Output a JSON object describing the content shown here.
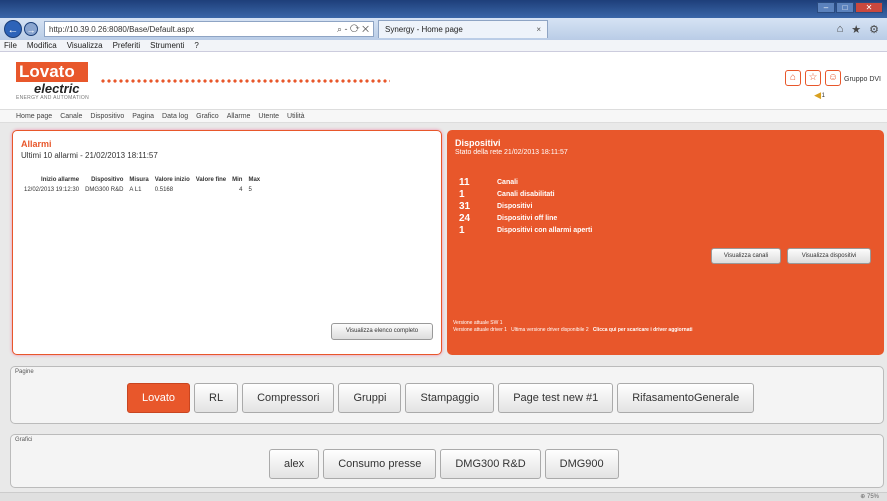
{
  "browser": {
    "url": "http://10.39.0.26:8080/Base/Default.aspx",
    "search_icon": "⌕ - ⟳ ✕",
    "tab_title": "Synergy - Home page",
    "tab_close": "×",
    "menu": [
      "File",
      "Modifica",
      "Visualizza",
      "Preferiti",
      "Strumenti",
      "?"
    ]
  },
  "header": {
    "logo_text": "Lovato",
    "logo_sub": "electric",
    "logo_tag": "ENERGY AND AUTOMATION",
    "user_group": "Gruppo DVI",
    "bell_count": "1"
  },
  "nav": [
    "Home page",
    "Canale",
    "Dispositivo",
    "Pagina",
    "Data log",
    "Grafico",
    "Allarme",
    "Utente",
    "Utilità"
  ],
  "alarms": {
    "title": "Allarmi",
    "subtitle": "Ultimi 10 allarmi - 21/02/2013 18:11:57",
    "columns": [
      "Inizio allarme",
      "Dispositivo",
      "Misura",
      "Valore inizio",
      "Valore fine",
      "Min",
      "Max"
    ],
    "rows": [
      [
        "12/02/2013 19:12:30",
        "DMG300 R&D",
        "A L1",
        "0.5168",
        "",
        "4",
        "5"
      ]
    ],
    "button": "Visualizza elenco completo"
  },
  "devices": {
    "title": "Dispositivi",
    "subtitle": "Stato della rete 21/02/2013 18:11:57",
    "stats": [
      {
        "n": "11",
        "label": "Canali"
      },
      {
        "n": "1",
        "label": "Canali disabilitati"
      },
      {
        "n": "31",
        "label": "Dispositivi"
      },
      {
        "n": "24",
        "label": "Dispositivi off line"
      },
      {
        "n": "1",
        "label": "Dispositivi con allarmi aperti"
      }
    ],
    "btn_channels": "Visualizza canali",
    "btn_devices": "Visualizza dispositivi",
    "version_sw": "Versione attuale SW 1",
    "version_driver": "Versione attuale driver 1",
    "latest_driver": "Ultima versione driver disponibile 2",
    "update_link": "Clicca qui per scaricare i driver aggiornati"
  },
  "pages": {
    "label": "Pagine",
    "items": [
      "Lovato",
      "RL",
      "Compressori",
      "Gruppi",
      "Stampaggio",
      "Page test new #1",
      "RifasamentoGenerale"
    ]
  },
  "graphs": {
    "label": "Grafici",
    "items": [
      "alex",
      "Consumo presse",
      "DMG300 R&D",
      "DMG900"
    ]
  },
  "footer": {
    "zoom": "⊕ 75%"
  }
}
